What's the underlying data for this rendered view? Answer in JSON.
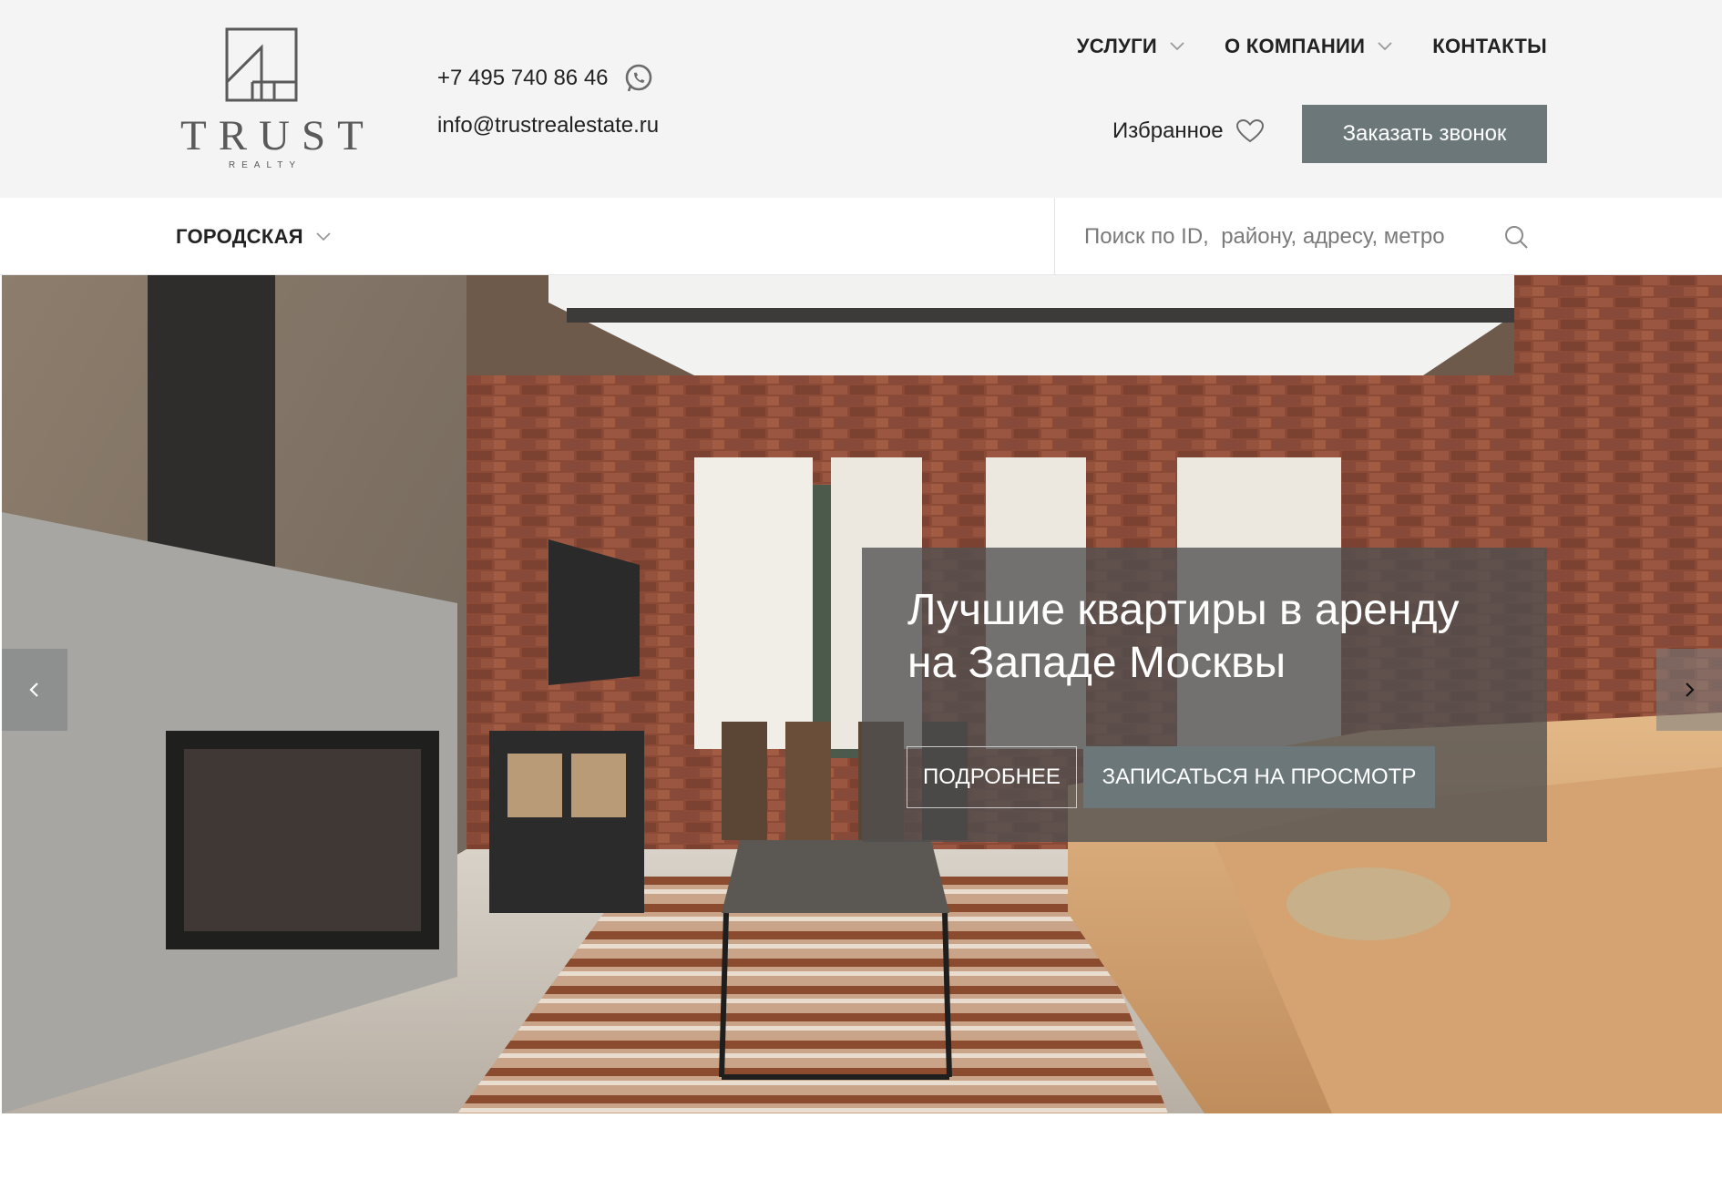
{
  "brand": {
    "name": "TRUST",
    "tagline": "REALTY"
  },
  "contacts": {
    "phone": "+7 495 740 86 46",
    "email": "info@trustrealestate.ru",
    "messenger_icon": "whatsapp-icon"
  },
  "nav": {
    "items": [
      {
        "label": "УСЛУГИ",
        "has_dropdown": true
      },
      {
        "label": "О КОМПАНИИ",
        "has_dropdown": true
      },
      {
        "label": "КОНТАКТЫ",
        "has_dropdown": false
      }
    ]
  },
  "favorites": {
    "label": "Избранное",
    "icon": "heart-icon"
  },
  "callback": {
    "label": "Заказать звонок"
  },
  "category": {
    "label": "ГОРОДСКАЯ"
  },
  "search": {
    "placeholder": "Поиск по ID,  району, адресу, метро",
    "value": ""
  },
  "hero": {
    "title_line1": "Лучшие квартиры в аренду",
    "title_line2": "на Западе Москвы",
    "more_label": "ПОДРОБНЕЕ",
    "view_label": "ЗАПИСАТЬСЯ НА ПРОСМОТР"
  },
  "colors": {
    "header_bg": "#f3f4f3",
    "accent": "#6b7778",
    "text": "#222222"
  }
}
